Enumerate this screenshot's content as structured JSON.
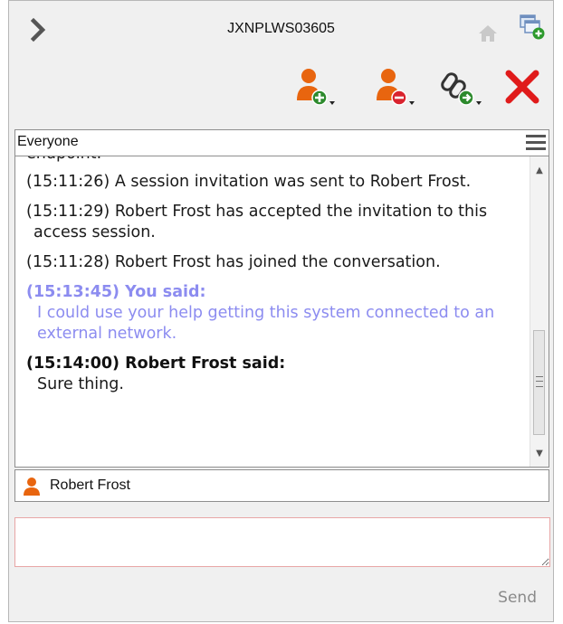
{
  "header": {
    "machine_name": "JXNPLWS03605",
    "icons": {
      "expand": "chevron-right-icon",
      "home": "home-icon",
      "new_window": "new-window-icon"
    }
  },
  "toolbar": {
    "buttons": [
      {
        "name": "add-participant",
        "icon": "user-plus-icon"
      },
      {
        "name": "remove-participant",
        "icon": "user-minus-icon"
      },
      {
        "name": "share-link",
        "icon": "link-add-icon"
      },
      {
        "name": "close",
        "icon": "close-icon"
      }
    ],
    "colors": {
      "user": "#e8650f",
      "add": "#2d8a2d",
      "remove": "#d9232e",
      "close": "#e01b1b"
    }
  },
  "channel": {
    "label": "Everyone"
  },
  "chat": {
    "clipped_text": "endpoint.",
    "messages": [
      {
        "kind": "system",
        "text": "(15:11:26) A session invitation was sent to Robert Frost."
      },
      {
        "kind": "system",
        "text": "(15:11:29) Robert Frost has accepted the invitation to this access session."
      },
      {
        "kind": "system",
        "text": "(15:11:28) Robert Frost has joined the conversation."
      },
      {
        "kind": "you",
        "head": "(15:13:45) You said:",
        "body": "I could use your help getting this system connected to an external network."
      },
      {
        "kind": "other",
        "head": "(15:14:00) Robert Frost said:",
        "body": "Sure thing."
      }
    ],
    "you_color": "#8c8cf0"
  },
  "participants": [
    {
      "name": "Robert Frost"
    }
  ],
  "composer": {
    "value": "",
    "send_label": "Send"
  }
}
